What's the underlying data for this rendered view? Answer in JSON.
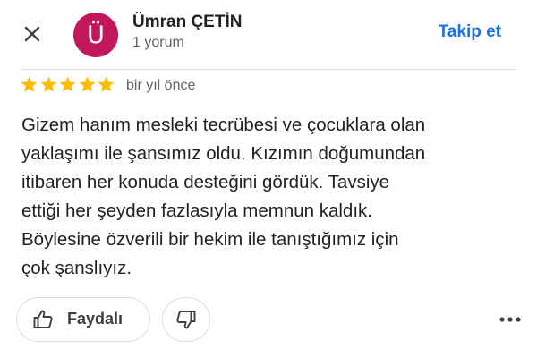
{
  "header": {
    "close_icon": "close-icon",
    "avatar_letter": "Ü",
    "avatar_color": "#c2185b",
    "user_name": "Ümran ÇETİN",
    "review_count": "1 yorum",
    "follow_label": "Takip et",
    "accent_color": "#1a73e8"
  },
  "review": {
    "rating": 5,
    "max_rating": 5,
    "star_color": "#fbbc04",
    "date": "bir yıl önce",
    "text_lines": [
      "Gizem hanım mesleki tecrübesi ve çocuklara olan",
      "yaklaşımı ile şansımız oldu. Kızımın doğumundan",
      "itibaren her konuda desteğini gördük. Tavsiye",
      "ettiği her şeyden fazlasıyla memnun kaldık.",
      "Böylesine özverili bir hekim ile tanıştığımız için",
      "çok şanslıyız."
    ]
  },
  "actions": {
    "helpful_label": "Faydalı",
    "helpful_icon": "thumbs-up-icon",
    "dislike_icon": "thumbs-down-icon",
    "more_icon": "more-horizontal-icon"
  }
}
